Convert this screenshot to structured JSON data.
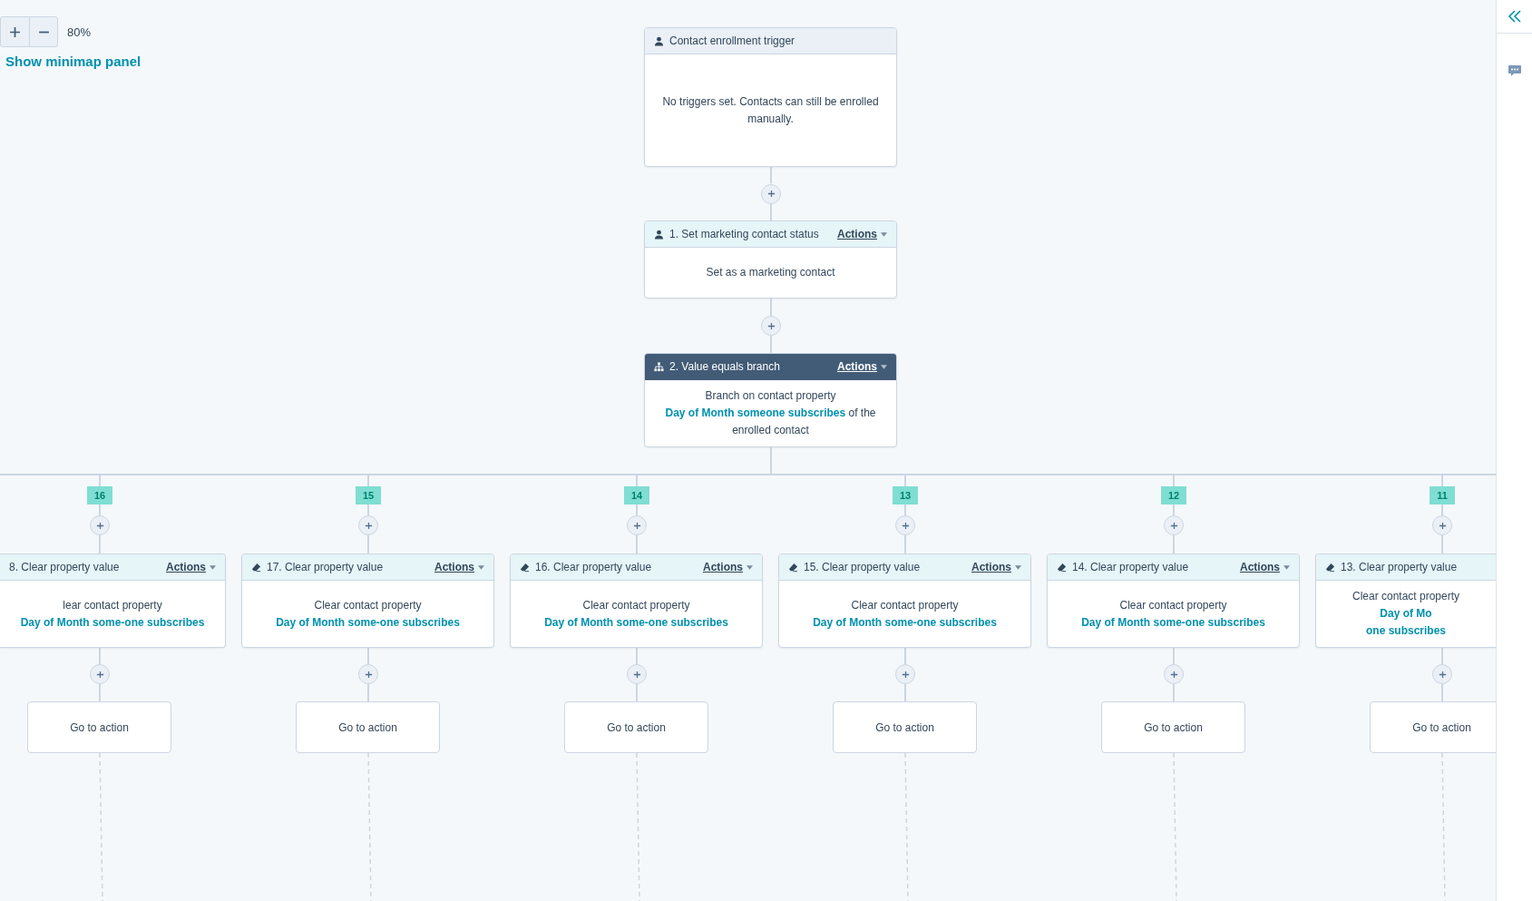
{
  "zoom": {
    "value": "80%"
  },
  "minimap_link": "Show minimap panel",
  "nodes": [
    {
      "kind": "trigger",
      "title": "Contact enrollment trigger",
      "body": [
        {
          "kind": "text",
          "text": "No triggers set. Contacts can still be enrolled manually."
        }
      ]
    },
    {
      "kind": "action",
      "title": "1. Set marketing contact status",
      "actions": "Actions",
      "body": [
        {
          "kind": "text",
          "text": "Set as a marketing contact"
        }
      ]
    },
    {
      "kind": "branch",
      "title": "2. Value equals branch",
      "actions": "Actions",
      "body": [
        {
          "kind": "text",
          "text": "Branch on contact property "
        },
        {
          "kind": "link",
          "text": "Day of Month someone subscribes"
        },
        {
          "kind": "text",
          "text": " of the enrolled contact"
        }
      ]
    }
  ],
  "branches": [
    {
      "badge": "16",
      "title": "8. Clear property value",
      "actions": "Actions",
      "body": [
        {
          "kind": "text",
          "text": "lear contact property "
        },
        {
          "kind": "link",
          "text": "Day of Month some-one subscribes"
        }
      ],
      "goto": "Go to action"
    },
    {
      "badge": "15",
      "title": "17. Clear property value",
      "actions": "Actions",
      "body": [
        {
          "kind": "text",
          "text": "Clear contact property "
        },
        {
          "kind": "link",
          "text": "Day of Month some-one subscribes"
        }
      ],
      "goto": "Go to action"
    },
    {
      "badge": "14",
      "title": "16. Clear property value",
      "actions": "Actions",
      "body": [
        {
          "kind": "text",
          "text": "Clear contact property "
        },
        {
          "kind": "link",
          "text": "Day of Month some-one subscribes"
        }
      ],
      "goto": "Go to action"
    },
    {
      "badge": "13",
      "title": "15. Clear property value",
      "actions": "Actions",
      "body": [
        {
          "kind": "text",
          "text": "Clear contact property "
        },
        {
          "kind": "link",
          "text": "Day of Month some-one subscribes"
        }
      ],
      "goto": "Go to action"
    },
    {
      "badge": "12",
      "title": "14. Clear property value",
      "actions": "Actions",
      "body": [
        {
          "kind": "text",
          "text": "Clear contact property "
        },
        {
          "kind": "link",
          "text": "Day of Month some-one subscribes"
        }
      ],
      "goto": "Go to action"
    },
    {
      "badge": "11",
      "title": "13. Clear property value",
      "body": [
        {
          "kind": "text",
          "text": "Clear contact property "
        },
        {
          "kind": "link",
          "text": "Day of Mo"
        },
        {
          "kind": "link-line",
          "text": "one subscribes"
        }
      ],
      "goto": "Go to action"
    }
  ]
}
